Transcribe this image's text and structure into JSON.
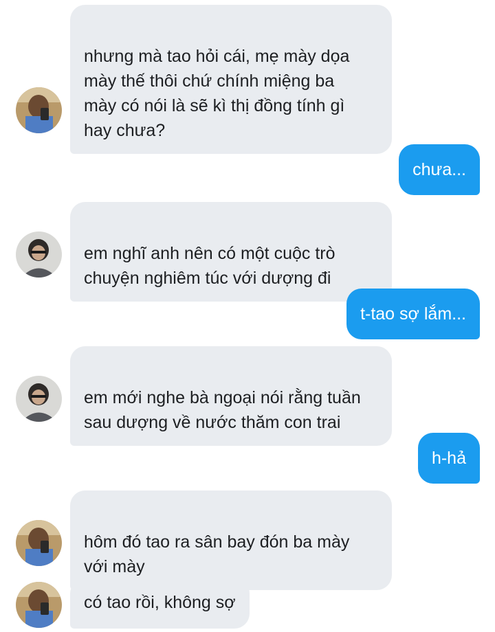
{
  "colors": {
    "incoming_bubble": "#e9ecf0",
    "outgoing_bubble": "#1b9cef",
    "incoming_text": "#1d1f22",
    "outgoing_text": "#ffffff"
  },
  "messages": [
    {
      "direction": "incoming",
      "avatar": "avatar-a",
      "text": "nhưng mà tao hỏi cái, mẹ mày dọa\nmày thế thôi chứ chính miệng ba\nmày có nói là sẽ kì thị đồng tính gì\nhay chưa?"
    },
    {
      "direction": "outgoing",
      "text": "chưa..."
    },
    {
      "direction": "incoming",
      "avatar": "avatar-b",
      "text": "em nghĩ anh nên có một cuộc trò\nchuyện nghiêm túc với dượng đi"
    },
    {
      "direction": "outgoing",
      "text": "t-tao sợ lắm..."
    },
    {
      "direction": "incoming",
      "avatar": "avatar-b",
      "text": "em mới nghe bà ngoại nói rằng tuần\nsau dượng về nước thăm con trai"
    },
    {
      "direction": "outgoing",
      "text": "h-hả"
    },
    {
      "direction": "incoming",
      "avatar": "avatar-a",
      "text": "hôm đó tao ra sân bay đón ba mày\nvới mày"
    },
    {
      "direction": "incoming",
      "avatar": "avatar-a",
      "text": "có tao rồi, không sợ"
    }
  ]
}
